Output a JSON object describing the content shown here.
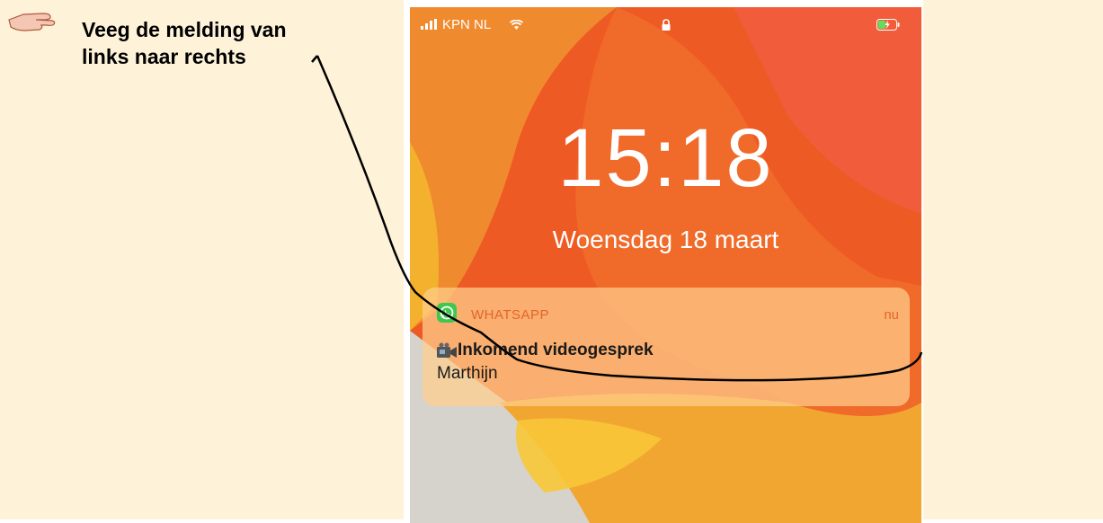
{
  "instruction": {
    "line1": "Veeg de melding van",
    "line2": "links naar rechts"
  },
  "status_bar": {
    "carrier": "KPN NL",
    "icons": [
      "signal-icon",
      "wifi-icon",
      "lock-icon",
      "battery-charging-icon"
    ]
  },
  "lockscreen": {
    "time": "15:18",
    "date": "Woensdag 18 maart"
  },
  "notification": {
    "app": "WHATSAPP",
    "time": "nu",
    "title": "Inkomend videogesprek",
    "sender": "Marthijn",
    "icons": [
      "whatsapp-icon",
      "video-camera-icon"
    ]
  },
  "colors": {
    "panel_background": "#fef3d8",
    "wallpaper_orange": "#ef5a24",
    "notification_accent": "#e3652a"
  }
}
